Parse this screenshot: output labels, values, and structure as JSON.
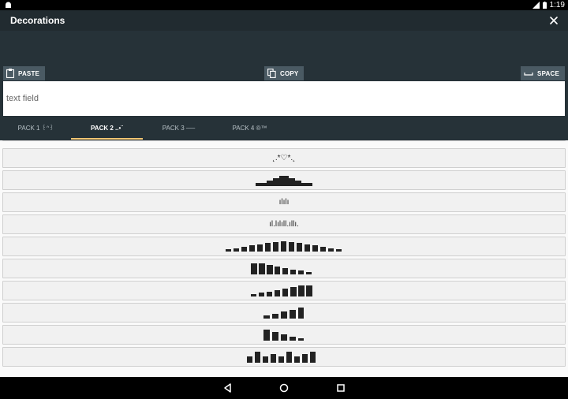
{
  "status_bar": {
    "time": "1:19"
  },
  "app_bar": {
    "title": "Decorations"
  },
  "toolbar": {
    "paste_label": "PASTE",
    "copy_label": "COPY",
    "space_label": "SPACE"
  },
  "text_field": {
    "placeholder": "text field",
    "value": ""
  },
  "tabs": [
    {
      "label": "PACK 1 ꒰ᐢ꒱",
      "active": false
    },
    {
      "label": "PACK 2 ..•¨",
      "active": true
    },
    {
      "label": "PACK 3 ──",
      "active": false
    },
    {
      "label": "PACK 4 ®™",
      "active": false
    }
  ],
  "decorations": {
    "row1_text": "˛.*♡*.˛",
    "row4_text": "ılılı",
    "row5_text": "ıl.lılıll.ıllı."
  },
  "colors": {
    "app_bar": "#212B30",
    "panel": "#263238",
    "button": "#4A5A63",
    "tab_indicator": "#F2C572",
    "row_bg": "#F1F1F1"
  }
}
